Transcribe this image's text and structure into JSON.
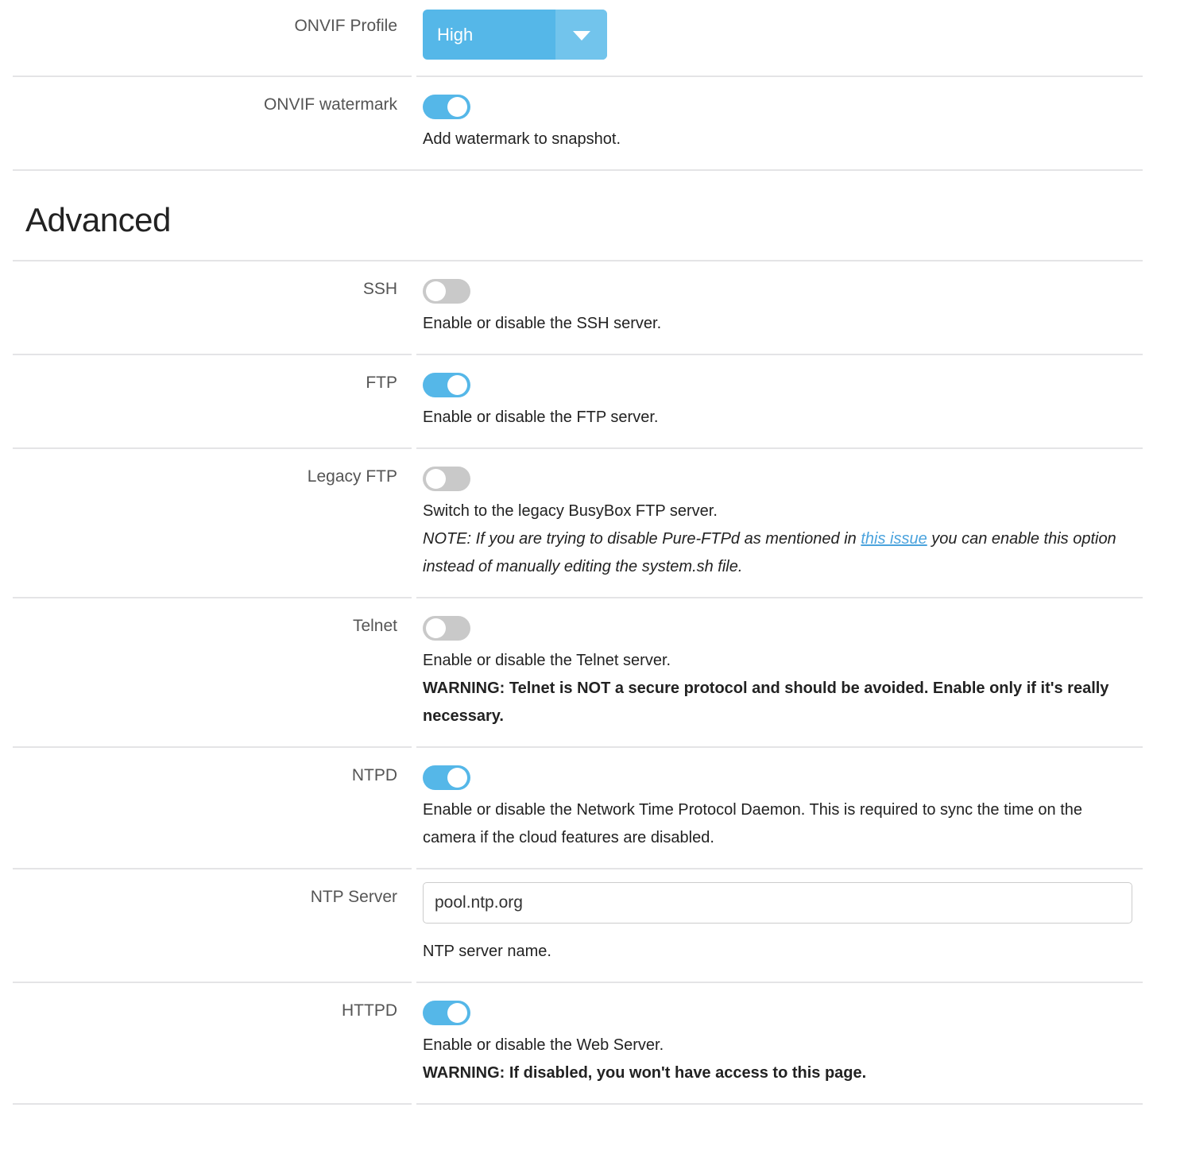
{
  "sections": [
    {
      "id": "onvif",
      "rows": [
        {
          "id": "onvif-profile",
          "label": "ONVIF Profile",
          "control": "select",
          "value": "High",
          "help": []
        },
        {
          "id": "onvif-watermark",
          "label": "ONVIF watermark",
          "control": "toggle",
          "state": "on",
          "help": [
            {
              "text": "Add watermark to snapshot."
            }
          ]
        }
      ]
    },
    {
      "id": "advanced",
      "heading": "Advanced",
      "rows": [
        {
          "id": "ssh",
          "label": "SSH",
          "control": "toggle",
          "state": "off",
          "help": [
            {
              "text": "Enable or disable the SSH server."
            }
          ]
        },
        {
          "id": "ftp",
          "label": "FTP",
          "control": "toggle",
          "state": "on",
          "help": [
            {
              "text": "Enable or disable the FTP server."
            }
          ]
        },
        {
          "id": "legacy-ftp",
          "label": "Legacy FTP",
          "control": "toggle",
          "state": "off",
          "help": [
            {
              "text": "Switch to the legacy BusyBox FTP server."
            },
            {
              "style": "note",
              "before": "NOTE: If you are trying to disable Pure-FTPd as mentioned in ",
              "link": "this issue",
              "after": " you can enable this option instead of manually editing the system.sh file."
            }
          ]
        },
        {
          "id": "telnet",
          "label": "Telnet",
          "control": "toggle",
          "state": "off",
          "help": [
            {
              "text": "Enable or disable the Telnet server."
            },
            {
              "style": "warn",
              "text": "WARNING: Telnet is NOT a secure protocol and should be avoided. Enable only if it's really necessary."
            }
          ]
        },
        {
          "id": "ntpd",
          "label": "NTPD",
          "control": "toggle",
          "state": "on",
          "help": [
            {
              "text": "Enable or disable the Network Time Protocol Daemon. This is required to sync the time on the camera if the cloud features are disabled."
            }
          ]
        },
        {
          "id": "ntp-server",
          "label": "NTP Server",
          "control": "text",
          "value": "pool.ntp.org",
          "placeholder": "",
          "help": [
            {
              "text": "NTP server name."
            }
          ]
        },
        {
          "id": "httpd",
          "label": "HTTPD",
          "control": "toggle",
          "state": "on",
          "help": [
            {
              "text": "Enable or disable the Web Server."
            },
            {
              "style": "warn",
              "text": "WARNING: If disabled, you won't have access to this page."
            }
          ]
        }
      ]
    }
  ],
  "colors": {
    "accent": "#55b7e8",
    "accent_light": "#72c4ec",
    "toggle_off": "#c9c9c9",
    "divider": "#e4e4e6",
    "link": "#4ba3dd",
    "label": "#555555"
  },
  "icons": {
    "dropdown_caret": "chevron-down-icon"
  }
}
